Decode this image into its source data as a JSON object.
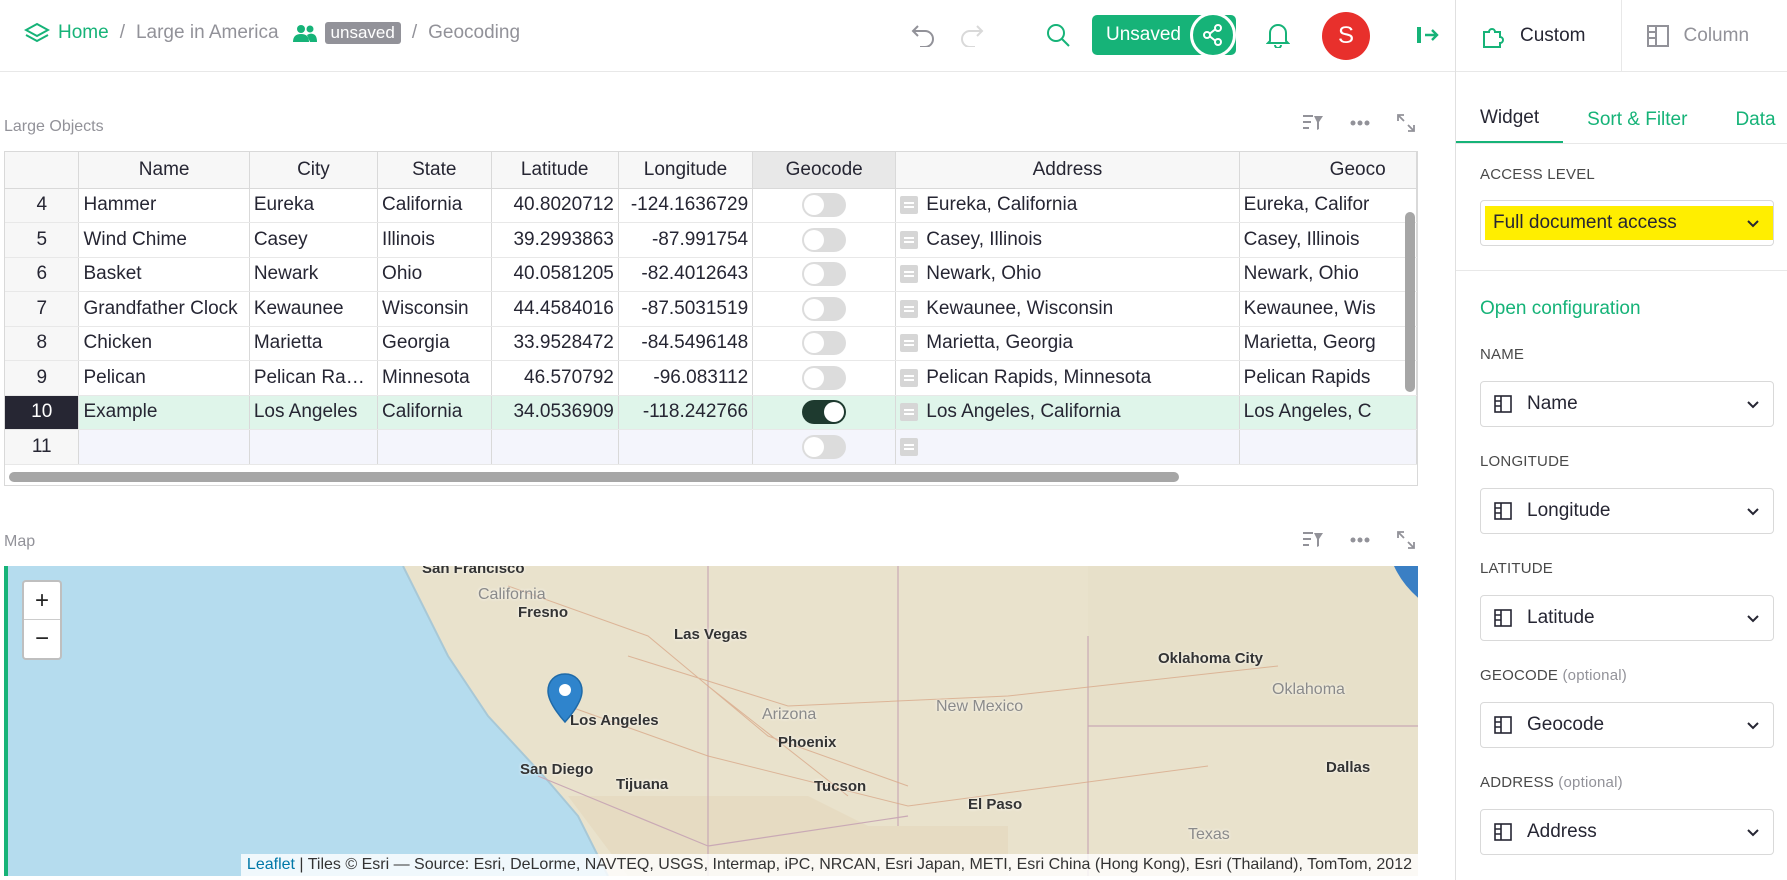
{
  "breadcrumb": {
    "home": "Home",
    "org": "Large in America",
    "badge": "unsaved",
    "page": "Geocoding"
  },
  "topbar": {
    "unsaved_label": "Unsaved",
    "avatar_initial": "S"
  },
  "panel": {
    "top_tabs": [
      "Custom",
      "Column"
    ],
    "sub_tabs": [
      "Widget",
      "Sort & Filter",
      "Data"
    ],
    "access_label": "ACCESS LEVEL",
    "access_value": "Full document access",
    "open_config": "Open configuration",
    "fields": [
      {
        "label": "NAME",
        "optional": "",
        "value": "Name"
      },
      {
        "label": "LONGITUDE",
        "optional": "",
        "value": "Longitude"
      },
      {
        "label": "LATITUDE",
        "optional": "",
        "value": "Latitude"
      },
      {
        "label": "GEOCODE",
        "optional": "(optional)",
        "value": "Geocode"
      },
      {
        "label": "ADDRESS",
        "optional": "(optional)",
        "value": "Address"
      }
    ]
  },
  "table": {
    "title": "Large Objects",
    "headers": [
      "Name",
      "City",
      "State",
      "Latitude",
      "Longitude",
      "Geocode",
      "Address",
      "Geoco"
    ],
    "rows": [
      {
        "n": "4",
        "name": "Hammer",
        "city": "Eureka",
        "state": "California",
        "lat": "40.8020712",
        "lon": "-124.1636729",
        "geo": false,
        "addr": "Eureka, California",
        "geo2": "Eureka, Califor"
      },
      {
        "n": "5",
        "name": "Wind Chime",
        "city": "Casey",
        "state": "Illinois",
        "lat": "39.2993863",
        "lon": "-87.991754",
        "geo": false,
        "addr": "Casey, Illinois",
        "geo2": "Casey, Illinois"
      },
      {
        "n": "6",
        "name": "Basket",
        "city": "Newark",
        "state": "Ohio",
        "lat": "40.0581205",
        "lon": "-82.4012643",
        "geo": false,
        "addr": "Newark, Ohio",
        "geo2": "Newark, Ohio"
      },
      {
        "n": "7",
        "name": "Grandfather Clock",
        "city": "Kewaunee",
        "state": "Wisconsin",
        "lat": "44.4584016",
        "lon": "-87.5031519",
        "geo": false,
        "addr": "Kewaunee, Wisconsin",
        "geo2": "Kewaunee, Wis"
      },
      {
        "n": "8",
        "name": "Chicken",
        "city": "Marietta",
        "state": "Georgia",
        "lat": "33.9528472",
        "lon": "-84.5496148",
        "geo": false,
        "addr": "Marietta, Georgia",
        "geo2": "Marietta, Georg"
      },
      {
        "n": "9",
        "name": "Pelican",
        "city": "Pelican Ra…",
        "state": "Minnesota",
        "lat": "46.570792",
        "lon": "-96.083112",
        "geo": false,
        "addr": "Pelican Rapids, Minnesota",
        "geo2": "Pelican Rapids"
      },
      {
        "n": "10",
        "name": "Example",
        "city": "Los Angeles",
        "state": "California",
        "lat": "34.0536909",
        "lon": "-118.242766",
        "geo": true,
        "addr": "Los Angeles, California",
        "geo2": "Los Angeles, C"
      },
      {
        "n": "11",
        "name": "",
        "city": "",
        "state": "",
        "lat": "",
        "lon": "",
        "geo": false,
        "addr": "",
        "geo2": ""
      }
    ]
  },
  "map": {
    "title": "Map",
    "zoom_in": "+",
    "zoom_out": "−",
    "attribution_link": "Leaflet",
    "attribution_text": " | Tiles © Esri — Source: Esri, DeLorme, NAVTEQ, USGS, Intermap, iPC, NRCAN, Esri Japan, METI, Esri China (Hong Kong), Esri (Thailand), TomTom, 2012",
    "cities": [
      "San Francisco",
      "Fresno",
      "Las Vegas",
      "Los Angeles",
      "San Diego",
      "Tijuana",
      "Phoenix",
      "Tucson",
      "El Paso",
      "Oklahoma City",
      "Dallas"
    ],
    "states": [
      "California",
      "Arizona",
      "New Mexico",
      "Oklahoma",
      "Texas"
    ]
  },
  "colors": {
    "accent": "#16b378",
    "avatar": "#e8302c",
    "selected_row": "#dff5ea",
    "highlight": "#ffee00"
  }
}
